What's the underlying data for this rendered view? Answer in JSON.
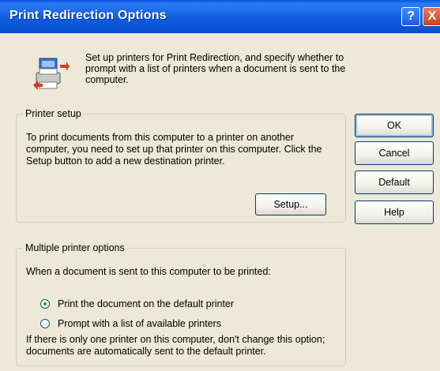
{
  "window": {
    "title": "Print Redirection Options",
    "help_glyph": "?",
    "close_glyph": "X"
  },
  "intro": {
    "text": "Set up printers for Print Redirection, and specify whether to prompt with a list of printers when a document is sent to the computer.",
    "icon": "printer-redirect-icon"
  },
  "printer_setup": {
    "title": "Printer setup",
    "description": "To print documents from this computer to a printer on another computer, you need to set up that printer on this computer. Click the Setup button to add a new destination printer.",
    "setup_label": "Setup..."
  },
  "multiple_printer": {
    "title": "Multiple printer options",
    "intro": "When a document is sent to this computer to be printed:",
    "options": [
      {
        "label": "Print the document on the default printer",
        "selected": true
      },
      {
        "label": "Prompt with a list of available printers",
        "selected": false
      }
    ],
    "note": "If there is only one printer on this computer, don't change this option; documents are automatically sent to the default printer."
  },
  "buttons": {
    "ok": "OK",
    "cancel": "Cancel",
    "default": "Default",
    "help": "Help"
  }
}
